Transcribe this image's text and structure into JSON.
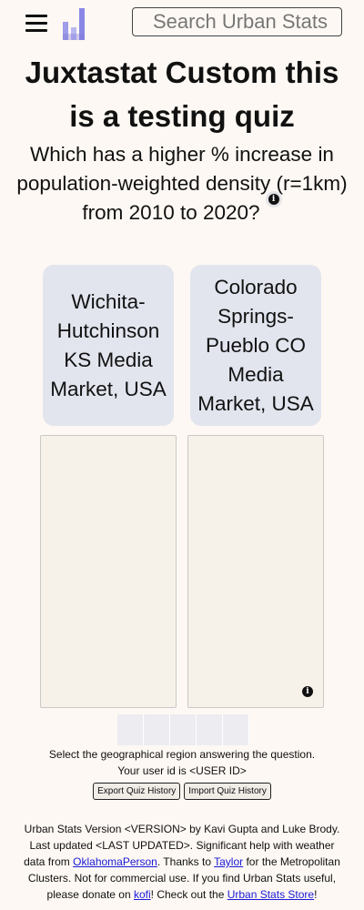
{
  "header": {
    "menu_icon": "hamburger-icon",
    "logo_icon": "urban-stats-bars-logo",
    "search_placeholder": "Search Urban Stats"
  },
  "quiz": {
    "title": "Juxtastat Custom this is a testing quiz",
    "question_main": "Which has a higher % increase in population-weighted density (r=1km)",
    "question_end": "from 2010 to 2020?",
    "info_icon": "info-icon",
    "choices": [
      {
        "label": "Wichita-Hutchinson KS Media Market, USA"
      },
      {
        "label": "Colorado Springs-Pueblo CO Media Market, USA"
      }
    ],
    "map_info_icon": "info-icon",
    "progress_boxes": 5,
    "help_line1": "Select the geographical region answering the question.",
    "help_line2": "Your user id is <USER ID>",
    "export_label": "Export Quiz History",
    "import_label": "Import Quiz History"
  },
  "footer": {
    "t1": "Urban Stats Version <VERSION> by Kavi Gupta and Luke Brody. Last updated <LAST UPDATED>. Significant help with weather data from ",
    "link1": "OklahomaPerson",
    "t2": ". Thanks to ",
    "link2": "Taylor",
    "t3": " for the Metropolitan Clusters. Not for commercial use. If you find Urban Stats useful, please donate on ",
    "link3": "kofi",
    "t4": "! Check out the ",
    "link4": "Urban Stats Store",
    "t5": "!"
  },
  "colors": {
    "background": "#fdf8f3",
    "choice_bg": "#e2e5ee",
    "logo_purple": "#8a86e6",
    "link": "#1a1ad6"
  }
}
